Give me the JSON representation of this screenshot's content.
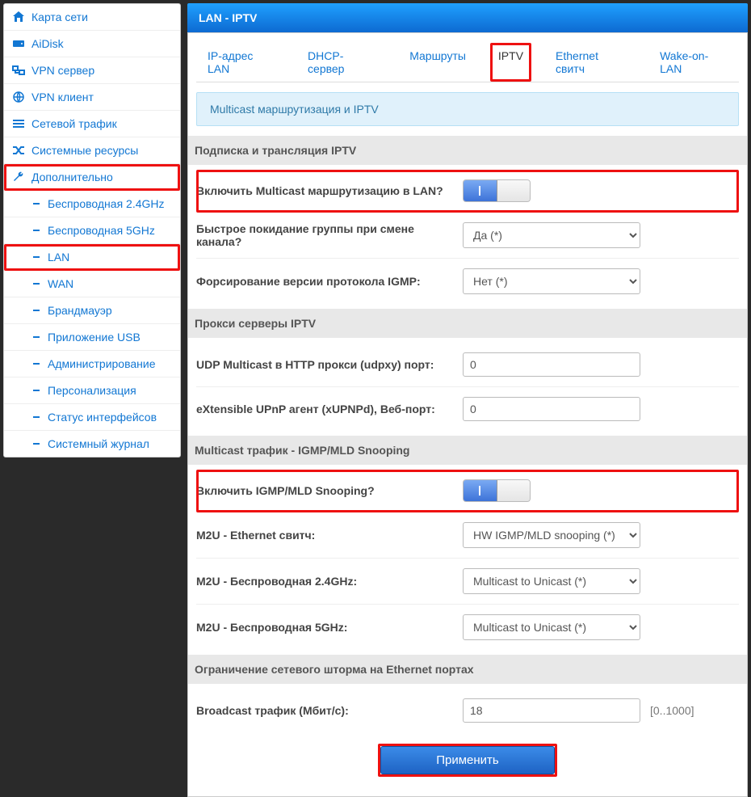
{
  "sidebar": {
    "items": [
      {
        "label": "Карта сети"
      },
      {
        "label": "AiDisk"
      },
      {
        "label": "VPN сервер"
      },
      {
        "label": "VPN клиент"
      },
      {
        "label": "Сетевой трафик"
      },
      {
        "label": "Системные ресурсы"
      },
      {
        "label": "Дополнительно"
      }
    ],
    "sub": [
      {
        "label": "Беспроводная 2.4GHz"
      },
      {
        "label": "Беспроводная 5GHz"
      },
      {
        "label": "LAN"
      },
      {
        "label": "WAN"
      },
      {
        "label": "Брандмауэр"
      },
      {
        "label": "Приложение USB"
      },
      {
        "label": "Администрирование"
      },
      {
        "label": "Персонализация"
      },
      {
        "label": "Статус интерфейсов"
      },
      {
        "label": "Системный журнал"
      }
    ]
  },
  "header": {
    "title": "LAN - IPTV"
  },
  "tabs": [
    {
      "label": "IP-адрес LAN"
    },
    {
      "label": "DHCP-сервер"
    },
    {
      "label": "Маршруты"
    },
    {
      "label": "IPTV"
    },
    {
      "label": "Ethernet свитч"
    },
    {
      "label": "Wake-on-LAN"
    }
  ],
  "infobox": "Multicast маршрутизация и IPTV",
  "sections": {
    "s1": {
      "title": "Подписка и трансляция IPTV",
      "r1": "Включить Multicast маршрутизацию в LAN?",
      "r2": "Быстрое покидание группы при смене канала?",
      "r2_val": "Да (*)",
      "r3": "Форсирование версии протокола IGMP:",
      "r3_val": "Нет (*)"
    },
    "s2": {
      "title": "Прокси серверы IPTV",
      "r1": "UDP Multicast в HTTP прокси (udpxy) порт:",
      "r1_val": "0",
      "r2": "eXtensible UPnP агент (xUPNPd), Веб-порт:",
      "r2_val": "0"
    },
    "s3": {
      "title": "Multicast трафик - IGMP/MLD Snooping",
      "r1": "Включить IGMP/MLD Snooping?",
      "r2": "M2U - Ethernet свитч:",
      "r2_val": "HW IGMP/MLD snooping (*)",
      "r3": "M2U - Беспроводная 2.4GHz:",
      "r3_val": "Multicast to Unicast (*)",
      "r4": "M2U - Беспроводная 5GHz:",
      "r4_val": "Multicast to Unicast (*)"
    },
    "s4": {
      "title": "Ограничение сетевого шторма на Ethernet портах",
      "r1": "Broadcast трафик (Мбит/с):",
      "r1_val": "18",
      "r1_hint": "[0..1000]"
    }
  },
  "apply": "Применить"
}
